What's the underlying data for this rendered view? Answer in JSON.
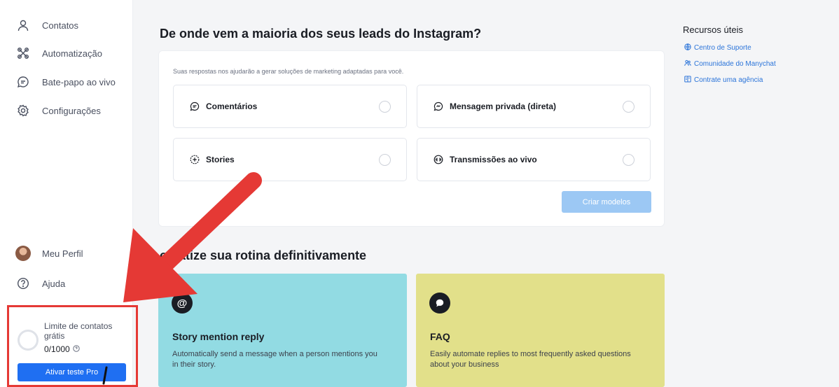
{
  "sidebar": {
    "nav": [
      {
        "label": "Contatos",
        "icon": "user-icon"
      },
      {
        "label": "Automatização",
        "icon": "automation-icon"
      },
      {
        "label": "Bate-papo ao vivo",
        "icon": "chat-icon"
      },
      {
        "label": "Configurações",
        "icon": "gear-icon"
      }
    ],
    "profile_label": "Meu Perfil",
    "help_label": "Ajuda",
    "limit": {
      "title": "Limite de contatos grátis",
      "count": "0/1000",
      "progress": 0,
      "button_label": "Ativar teste Pro"
    }
  },
  "main": {
    "question_title": "De onde vem a maioria dos seus leads do Instagram?",
    "subtitle": "Suas respostas nos ajudarão a gerar soluções de marketing adaptadas para você.",
    "options": [
      {
        "label": "Comentários",
        "icon": "comment-icon",
        "selected": false
      },
      {
        "label": "Mensagem privada (direta)",
        "icon": "message-icon",
        "selected": false
      },
      {
        "label": "Stories",
        "icon": "stories-plus-icon",
        "selected": false
      },
      {
        "label": "Transmissões ao vivo",
        "icon": "live-icon",
        "selected": false
      }
    ],
    "create_button": "Criar modelos",
    "section_title": "omatize sua rotina definitivamente",
    "templates": [
      {
        "icon_glyph": "@",
        "icon": "at-icon",
        "title": "Story mention reply",
        "description": "Automatically send a message when a person mentions you in their story.",
        "color": "#92dbe3"
      },
      {
        "icon_glyph": "",
        "icon": "speech-bubble-icon",
        "title": "FAQ",
        "description": "Easily automate replies to most frequently asked questions about your business",
        "color": "#e2e08a"
      }
    ]
  },
  "resources": {
    "title": "Recursos úteis",
    "links": [
      {
        "label": "Centro de Suporte",
        "icon": "globe-icon"
      },
      {
        "label": "Comunidade do Manychat",
        "icon": "community-icon"
      },
      {
        "label": "Contrate uma agência",
        "icon": "agency-icon"
      }
    ]
  },
  "colors": {
    "accent": "#1f6ff2",
    "annotation_red": "#e53935",
    "link": "#2b74d9"
  }
}
